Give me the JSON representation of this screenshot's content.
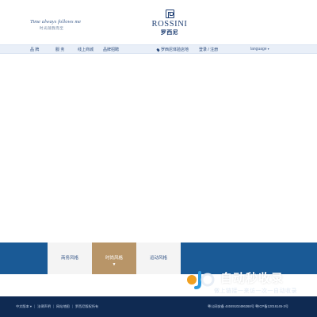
{
  "header": {
    "slogan_en": "Time always follows me",
    "slogan_cn": "时光随我而至",
    "brand_name": "ROSSINI",
    "brand_cn": "罗西尼"
  },
  "nav": {
    "items": [
      {
        "label": "品 牌"
      },
      {
        "label": "服 务"
      },
      {
        "label": "线上商城"
      },
      {
        "label": "品牌招聘"
      }
    ],
    "store_locator": "罗西尼体验店地",
    "login": "登录 / 注册",
    "language": "language",
    "language_caret": "▾"
  },
  "style_tabs": [
    {
      "label": "商务风格",
      "active": false
    },
    {
      "label": "时尚风格",
      "active": true,
      "indicator": "▼"
    },
    {
      "label": "运动风格",
      "active": false
    }
  ],
  "watermark": {
    "title": "自动秒收录",
    "subtitle": "做上链接一来访一次一自动收录"
  },
  "footer": {
    "links": [
      "中文版本 ▾",
      "法律声明",
      "网站地图",
      "罗西尼版权所有"
    ],
    "icp": "粤公网安备 44049102496268号  粤ICP备12016145-3号"
  },
  "colors": {
    "brand_navy": "#1f3f73",
    "nav_bg": "#e9eff8",
    "band_blue": "#1a5a96",
    "active_tab": "#b89568",
    "footer_bg": "#0f2a52"
  }
}
